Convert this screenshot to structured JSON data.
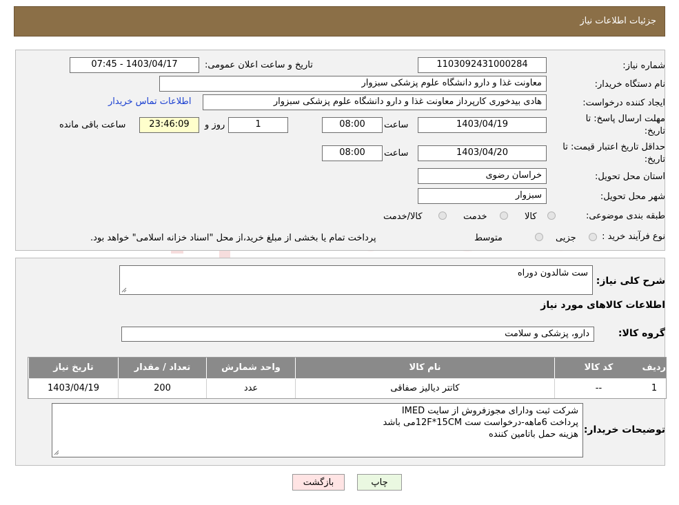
{
  "header": {
    "title": "جزئیات اطلاعات نیاز"
  },
  "form": {
    "need_number_label": "شماره نیاز:",
    "need_number": "1103092431000284",
    "announce_label": "تاریخ و ساعت اعلان عمومی:",
    "announce_value": "1403/04/17 - 07:45",
    "buyer_org_label": "نام دستگاه خریدار:",
    "buyer_org": "معاونت غذا و دارو   دانشگاه علوم پزشکی سبزوار",
    "creator_label": "ایجاد کننده درخواست:",
    "creator": "هادی بیدخوری کارپرداز معاونت غذا و دارو   دانشگاه علوم پزشکی سبزوار",
    "contact_link": "اطلاعات تماس خریدار",
    "deadline_label_1": "مهلت ارسال پاسخ: تا",
    "deadline_label_2": "تاریخ:",
    "deadline_date": "1403/04/19",
    "time_label": "ساعت",
    "deadline_time": "08:00",
    "days_value": "1",
    "days_label": "روز و",
    "remaining_time": "23:46:09",
    "remaining_label": "ساعت باقی مانده",
    "validity_label_1": "حداقل تاریخ اعتبار قیمت: تا",
    "validity_label_2": "تاریخ:",
    "validity_date": "1403/04/20",
    "validity_time_label": "ساعت",
    "validity_time": "08:00",
    "province_label": "استان محل تحویل:",
    "province": "خراسان رضوی",
    "city_label": "شهر محل تحویل:",
    "city": "سبزوار",
    "category_label": "طبقه بندی موضوعی:",
    "category_options": [
      "کالا",
      "خدمت",
      "کالا/خدمت"
    ],
    "process_label": "نوع فرآیند خرید :",
    "process_options": [
      "جزیی",
      "متوسط"
    ],
    "process_note": "پرداخت تمام یا بخشی از مبلغ خرید،از محل \"اسناد خزانه اسلامی\" خواهد بود."
  },
  "details": {
    "summary_label": "شرح کلی نیاز:",
    "summary": "ست شالدون دوراه",
    "goods_info_title": "اطلاعات کالاهای مورد نیاز",
    "goods_group_label": "گروه کالا:",
    "goods_group": "دارو، پزشکی و سلامت"
  },
  "table": {
    "headers": [
      "ردیف",
      "کد کالا",
      "نام کالا",
      "واحد شمارش",
      "تعداد / مقدار",
      "تاریخ نیاز"
    ],
    "rows": [
      [
        "1",
        "--",
        "کاتتر دیالیز صفاقی",
        "عدد",
        "200",
        "1403/04/19"
      ]
    ]
  },
  "buyer_notes": {
    "label": "توضیحات خریدار:",
    "lines": [
      "شرکت ثبت ودارای مجوزفروش از سایت IMED",
      "پرداخت 6ماهه-درخواست ست 12F*15CMمی باشد",
      "هزینه حمل باتامین کننده"
    ]
  },
  "buttons": {
    "back": "بازگشت",
    "print": "چاپ"
  },
  "watermark": {
    "text": "AriaTender.neT"
  },
  "colors": {
    "header": "#8b6f47",
    "table_header": "#8a8a8a",
    "link": "#1a3fd1",
    "back_button": "#ffe4e4",
    "print_button": "#eaf8e1"
  }
}
